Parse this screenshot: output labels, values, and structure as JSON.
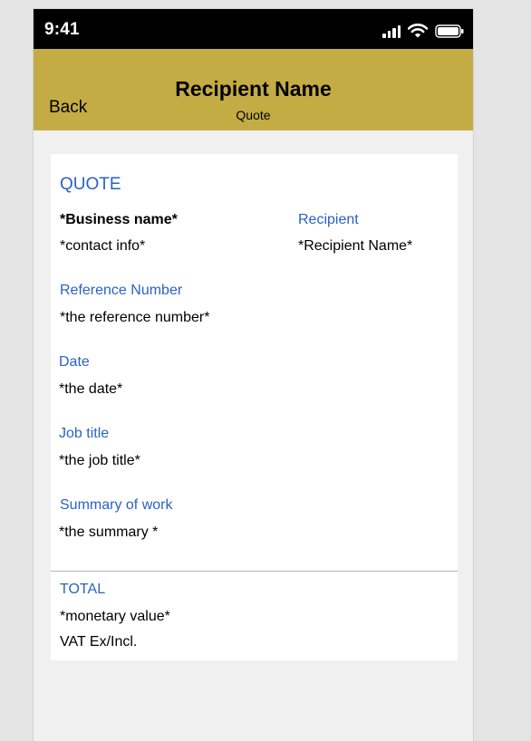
{
  "status_bar": {
    "time": "9:41",
    "icons": [
      "signal-icon",
      "wifi-icon",
      "battery-icon"
    ]
  },
  "nav": {
    "back_label": "Back",
    "title": "Recipient Name",
    "subtitle": "Quote"
  },
  "quote": {
    "heading": "QUOTE",
    "business_name": "*Business name*",
    "contact_info": "*contact info*",
    "recipient_label": "Recipient",
    "recipient_name": "*Recipient Name*",
    "reference_label": "Reference Number",
    "reference_value": "*the reference number*",
    "date_label": "Date",
    "date_value": "*the date*",
    "job_title_label": "Job title",
    "job_title_value": "*the job title*",
    "summary_label": "Summary of work",
    "summary_value": "*the summary *",
    "total_label": "TOTAL",
    "total_value": "*monetary value*",
    "vat_note": "VAT Ex/Incl."
  },
  "colors": {
    "nav_background": "#c4ac45",
    "label_blue": "#2a62c4",
    "status_bar": "#000000",
    "screen_background": "#f0f0f0"
  }
}
